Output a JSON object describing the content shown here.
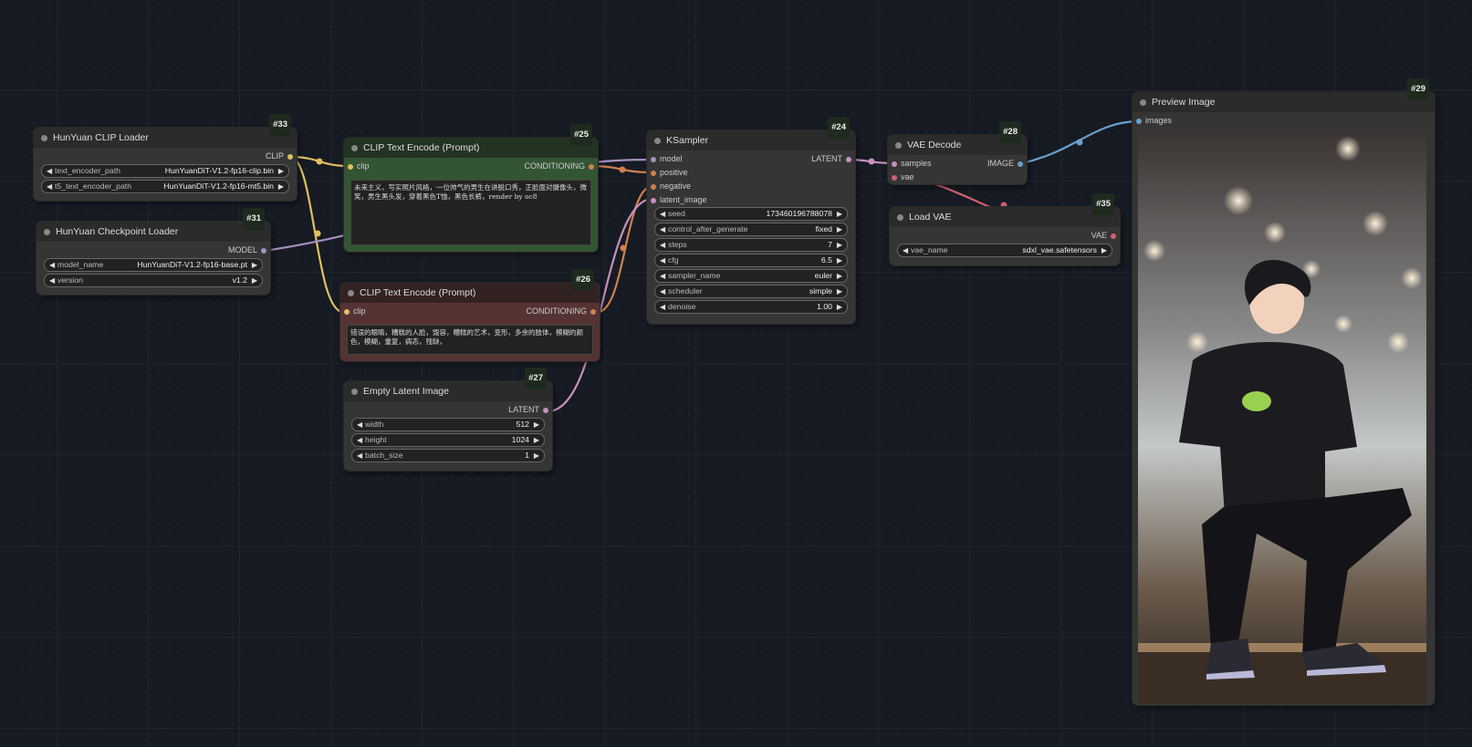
{
  "colors": {
    "clip": "#ffd500",
    "model": "#b39ddb",
    "conditioning": "#ffa931",
    "latent": "#ff9cf9",
    "vae": "#ff6e6e",
    "image": "#64b5f6"
  },
  "nodes": {
    "clip_loader": {
      "id": "#33",
      "title": "HunYuan CLIP Loader",
      "out": "CLIP",
      "w1_name": "text_encoder_path",
      "w1_val": "HunYuanDiT-V1.2-fp16-clip.bin",
      "w2_name": "t5_text_encoder_path",
      "w2_val": "HunYuanDiT-V1.2-fp16-mt5.bin"
    },
    "ckpt_loader": {
      "id": "#31",
      "title": "HunYuan Checkpoint Loader",
      "out": "MODEL",
      "w1_name": "model_name",
      "w1_val": "HunYuanDiT-V1.2-fp16-base.pt",
      "w2_name": "version",
      "w2_val": "v1.2"
    },
    "pos_prompt": {
      "id": "#25",
      "title": "CLIP Text Encode (Prompt)",
      "in": "clip",
      "out": "CONDITIONING",
      "text": "未来主义，写实照片风格，一位帅气的男生在讲脱口秀，正脸面对摄像头，微笑，男生黑头发，穿着黑色T恤，黑色长裤，render by oc8"
    },
    "neg_prompt": {
      "id": "#26",
      "title": "CLIP Text Encode (Prompt)",
      "in": "clip",
      "out": "CONDITIONING",
      "text": "错误的眼睛，糟糕的人脸，毁容，糟糕的艺术，变形，多余的肢体，模糊的颜色，模糊，重复，病态，残缺，"
    },
    "latent": {
      "id": "#27",
      "title": "Empty Latent Image",
      "out": "LATENT",
      "widgets": [
        {
          "name": "width",
          "value": "512"
        },
        {
          "name": "height",
          "value": "1024"
        },
        {
          "name": "batch_size",
          "value": "1"
        }
      ]
    },
    "ksampler": {
      "id": "#24",
      "title": "KSampler",
      "inputs": [
        "model",
        "positive",
        "negative",
        "latent_image"
      ],
      "out": "LATENT",
      "widgets": [
        {
          "name": "seed",
          "value": "173460196788078"
        },
        {
          "name": "control_after_generate",
          "value": "fixed"
        },
        {
          "name": "steps",
          "value": "7"
        },
        {
          "name": "cfg",
          "value": "6.5"
        },
        {
          "name": "sampler_name",
          "value": "euler"
        },
        {
          "name": "scheduler",
          "value": "simple"
        },
        {
          "name": "denoise",
          "value": "1.00"
        }
      ]
    },
    "vae_decode": {
      "id": "#28",
      "title": "VAE Decode",
      "in1": "samples",
      "in2": "vae",
      "out": "IMAGE"
    },
    "load_vae": {
      "id": "#35",
      "title": "Load VAE",
      "out": "VAE",
      "w1_name": "vae_name",
      "w1_val": "sdxl_vae.safetensors"
    },
    "preview": {
      "id": "#29",
      "title": "Preview Image",
      "in": "images"
    }
  }
}
